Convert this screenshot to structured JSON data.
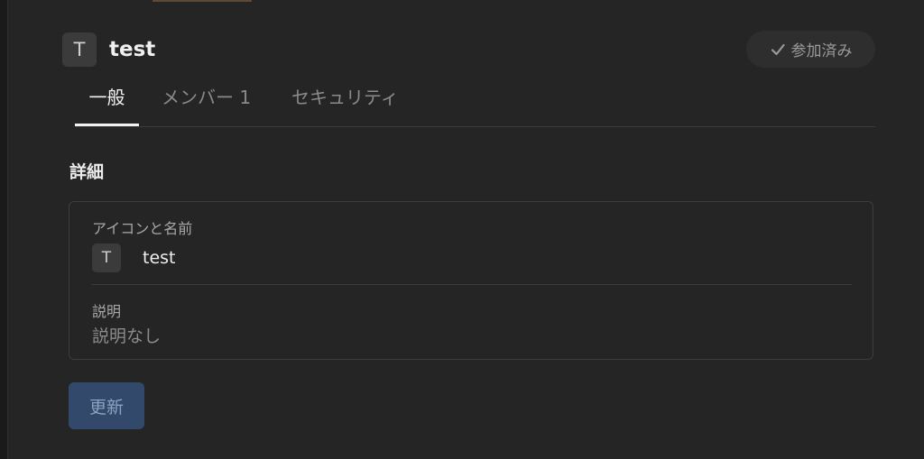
{
  "workspace": {
    "icon_letter": "T",
    "name": "test",
    "joined_label": "参加済み"
  },
  "tabs": [
    {
      "label": "一般",
      "active": true
    },
    {
      "label": "メンバー 1",
      "active": false
    },
    {
      "label": "セキュリティ",
      "active": false
    }
  ],
  "details": {
    "section_title": "詳細",
    "icon_name_label": "アイコンと名前",
    "icon_letter": "T",
    "name_value": "test",
    "description_label": "説明",
    "description_value": "説明なし"
  },
  "actions": {
    "update_label": "更新"
  },
  "colors": {
    "background": "#252525",
    "button_bg": "#33496b",
    "accent_text": "#f2f2f2"
  }
}
